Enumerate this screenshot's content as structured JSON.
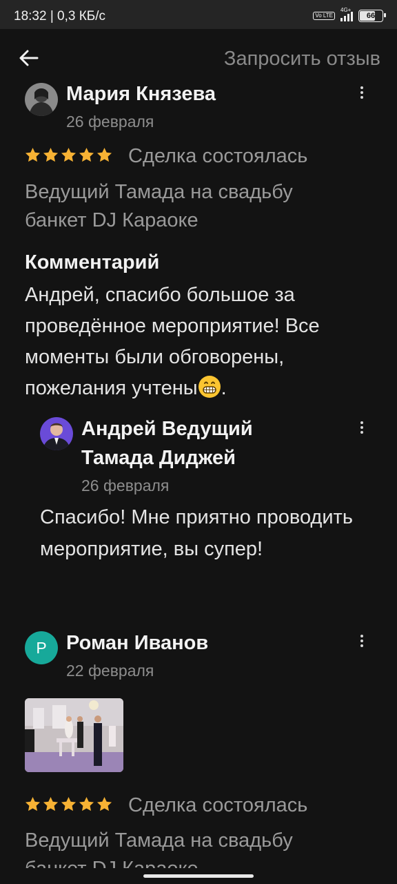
{
  "status_bar": {
    "time_speed": "18:32 | 0,3 КБ/с",
    "volte": "Vo LTE",
    "network": "4G+",
    "battery": "66",
    "battery_level": 0.66
  },
  "header": {
    "back_icon": "arrow-left-icon",
    "request_review": "Запросить отзыв"
  },
  "reviews": [
    {
      "author": "Мария Князева",
      "date": "26 февраля",
      "rating": 5,
      "status": "Сделка состоялась",
      "service": "Ведущий Тамада на свадьбу банкет DJ Караоке",
      "comment_heading": "Комментарий",
      "comment": "Андрей, спасибо большое за проведённое мероприятие! Все моменты были обговорены, пожелания учтены",
      "comment_end": ".",
      "reply": {
        "author": "Андрей Ведущий Тамада Диджей",
        "date": "26 февраля",
        "text": "Спасибо! Мне приятно проводить мероприятие, вы супер!"
      }
    },
    {
      "author": "Роман Иванов",
      "avatar_letter": "Р",
      "date": "22 февраля",
      "rating": 5,
      "status": "Сделка состоялась",
      "service": "Ведущий Тамада на свадьбу банкет DJ Караоке"
    }
  ],
  "colors": {
    "background": "#131313",
    "star": "#f7b234",
    "avatar_teal": "#17a99a",
    "muted_text": "#9a9a9a"
  }
}
